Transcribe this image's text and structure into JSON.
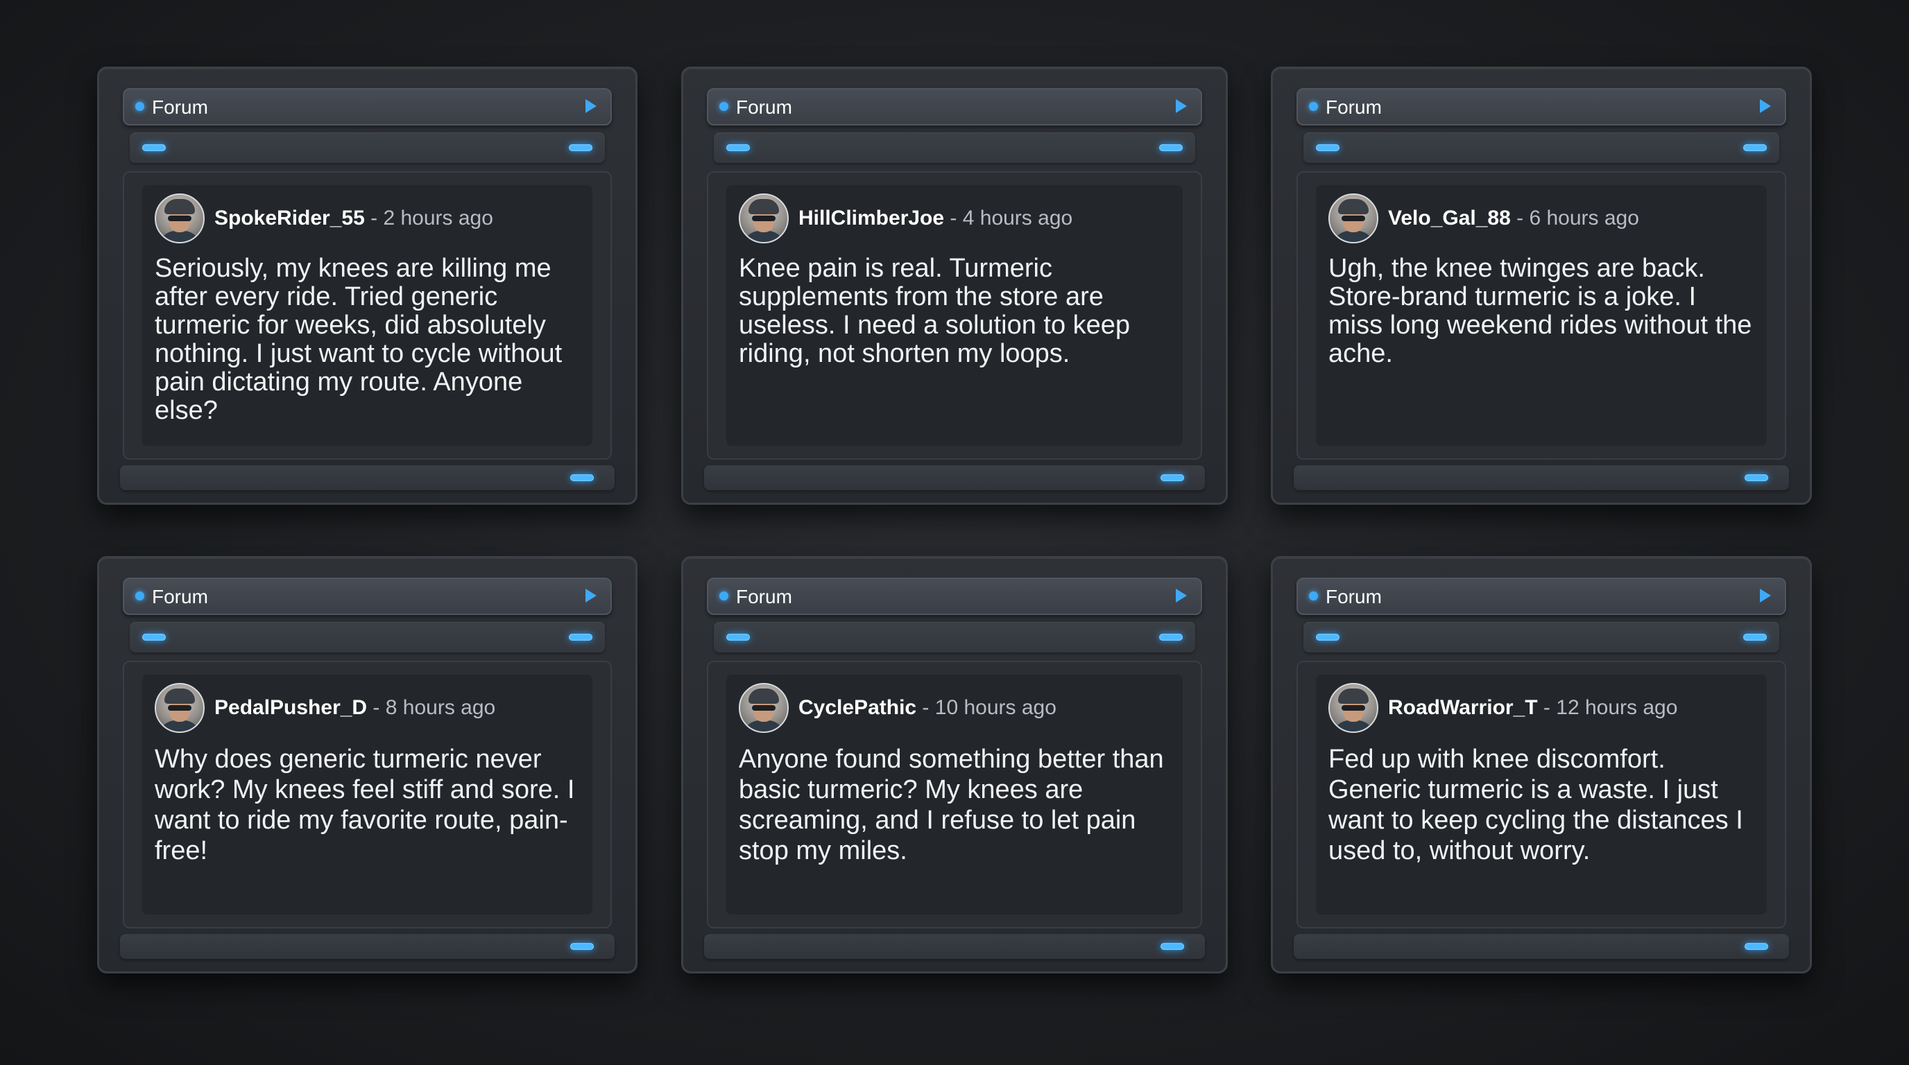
{
  "posts": [
    {
      "title": "Forum",
      "username": "SpokeRider_55",
      "separator": " - ",
      "time": "2 hours ago",
      "text": "Seriously, my knees are killing me after every ride. Tried generic turmeric for weeks, did absolutely nothing. I just want to cycle without pain dictating my route. Anyone else?"
    },
    {
      "title": "Forum",
      "username": "HillClimberJoe",
      "separator": " - ",
      "time": "4 hours ago",
      "text": "Knee pain is real. Turmeric supplements from the store are useless. I need a solution to keep riding, not shorten my loops."
    },
    {
      "title": "Forum",
      "username": "Velo_Gal_88",
      "separator": " - ",
      "time": "6 hours ago",
      "text": "Ugh, the knee twinges are back. Store-brand turmeric is a joke. I miss long weekend rides without the ache."
    },
    {
      "title": "Forum",
      "username": "PedalPusher_D",
      "separator": " - ",
      "time": "8 hours ago",
      "text": "Why does generic turmeric never work? My knees feel stiff and sore. I want to ride my favorite route, pain-free!"
    },
    {
      "title": "Forum",
      "username": "CyclePathic",
      "separator": " - ",
      "time": "10 hours ago",
      "text": "Anyone found something better than basic turmeric? My knees are screaming, and I refuse to let pain stop my miles."
    },
    {
      "title": "Forum",
      "username": "RoadWarrior_T",
      "separator": " - ",
      "time": "12 hours ago",
      "text": "Fed up with knee discomfort. Generic turmeric is a waste. I just want to keep cycling the distances I used to, without worry."
    }
  ],
  "colors": {
    "accent": "#3fa9f5",
    "background": "#1d1f22",
    "card": "#2b2e33",
    "text": "#f2f3f5",
    "muted": "#b9bdc3"
  },
  "icons": {
    "title_indicator": "dot-icon",
    "title_action": "play-arrow-icon",
    "avatar": "cyclist-avatar"
  }
}
